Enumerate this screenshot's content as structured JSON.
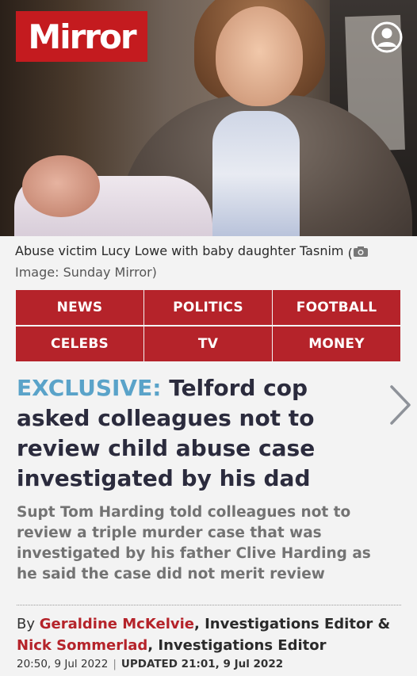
{
  "brand": {
    "name": "Mirror",
    "color": "#c41b1f"
  },
  "header": {
    "account_icon": "user-account-icon"
  },
  "hero": {
    "caption": "Abuse victim Lucy Lowe with baby daughter Tasnim",
    "credit": "Image: Sunday Mirror)",
    "camera_icon": "camera-icon"
  },
  "nav": {
    "items": [
      {
        "label": "NEWS"
      },
      {
        "label": "POLITICS"
      },
      {
        "label": "FOOTBALL"
      },
      {
        "label": "CELEBS"
      },
      {
        "label": "TV"
      },
      {
        "label": "MONEY"
      }
    ],
    "color": "#b5232a"
  },
  "article": {
    "exclusive_label": "EXCLUSIVE:",
    "headline": "Telford cop asked colleagues not to review child abuse case investigated by his dad",
    "standfirst": "Supt Tom Harding told colleagues not to review a triple murder case that was investigated by his father Clive Harding as he said the case did not merit review",
    "byline": {
      "prefix": "By",
      "authors": [
        {
          "name": "Geraldine McKelvie",
          "role": ", Investigations Editor &"
        },
        {
          "name": "Nick Sommerlad",
          "role": ", Investigations Editor"
        }
      ]
    },
    "published": "20:50, 9 Jul 2022",
    "updated": "UPDATED 21:01, 9 Jul 2022"
  }
}
